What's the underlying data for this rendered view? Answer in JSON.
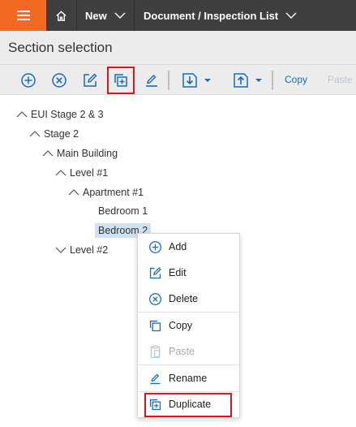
{
  "topbar": {
    "menu_icon": "hamburger-icon",
    "home_icon": "home-icon",
    "new_label": "New",
    "doc_label": "Document / Inspection List",
    "colors": {
      "bar": "#3f3f3f",
      "menu": "#f26a21"
    }
  },
  "page": {
    "title": "Section selection"
  },
  "toolbar": {
    "buttons": [
      {
        "icon": "add-circle-icon"
      },
      {
        "icon": "delete-circle-icon"
      },
      {
        "icon": "edit-icon"
      },
      {
        "icon": "duplicate-icon",
        "highlighted": true
      },
      {
        "icon": "rename-pencil-icon"
      },
      {
        "icon": "move-down-icon"
      },
      {
        "icon": "move-up-icon"
      }
    ],
    "copy_label": "Copy",
    "paste_label": "Paste",
    "accent": "#1569c7"
  },
  "tree": {
    "nodes": [
      {
        "label": "EUI Stage 2 & 3",
        "expanded": true
      },
      {
        "label": "Stage 2",
        "expanded": true
      },
      {
        "label": "Main Building",
        "expanded": true
      },
      {
        "label": "Level #1",
        "expanded": true
      },
      {
        "label": "Apartment #1",
        "expanded": true
      },
      {
        "label": "Bedroom 1"
      },
      {
        "label": "Bedroom 2",
        "selected": true
      },
      {
        "label": "Level #2",
        "expanded": false
      }
    ]
  },
  "context_menu": {
    "items": [
      {
        "label": "Add",
        "icon": "add-circle-icon"
      },
      {
        "label": "Edit",
        "icon": "edit-icon"
      },
      {
        "label": "Delete",
        "icon": "delete-circle-icon"
      },
      {
        "label": "Copy",
        "icon": "copy-icon"
      },
      {
        "label": "Paste",
        "icon": "paste-icon",
        "disabled": true
      },
      {
        "label": "Rename",
        "icon": "rename-pencil-icon"
      },
      {
        "label": "Duplicate",
        "icon": "duplicate-icon",
        "highlighted": true
      }
    ],
    "highlight_color": "#d8161b"
  }
}
